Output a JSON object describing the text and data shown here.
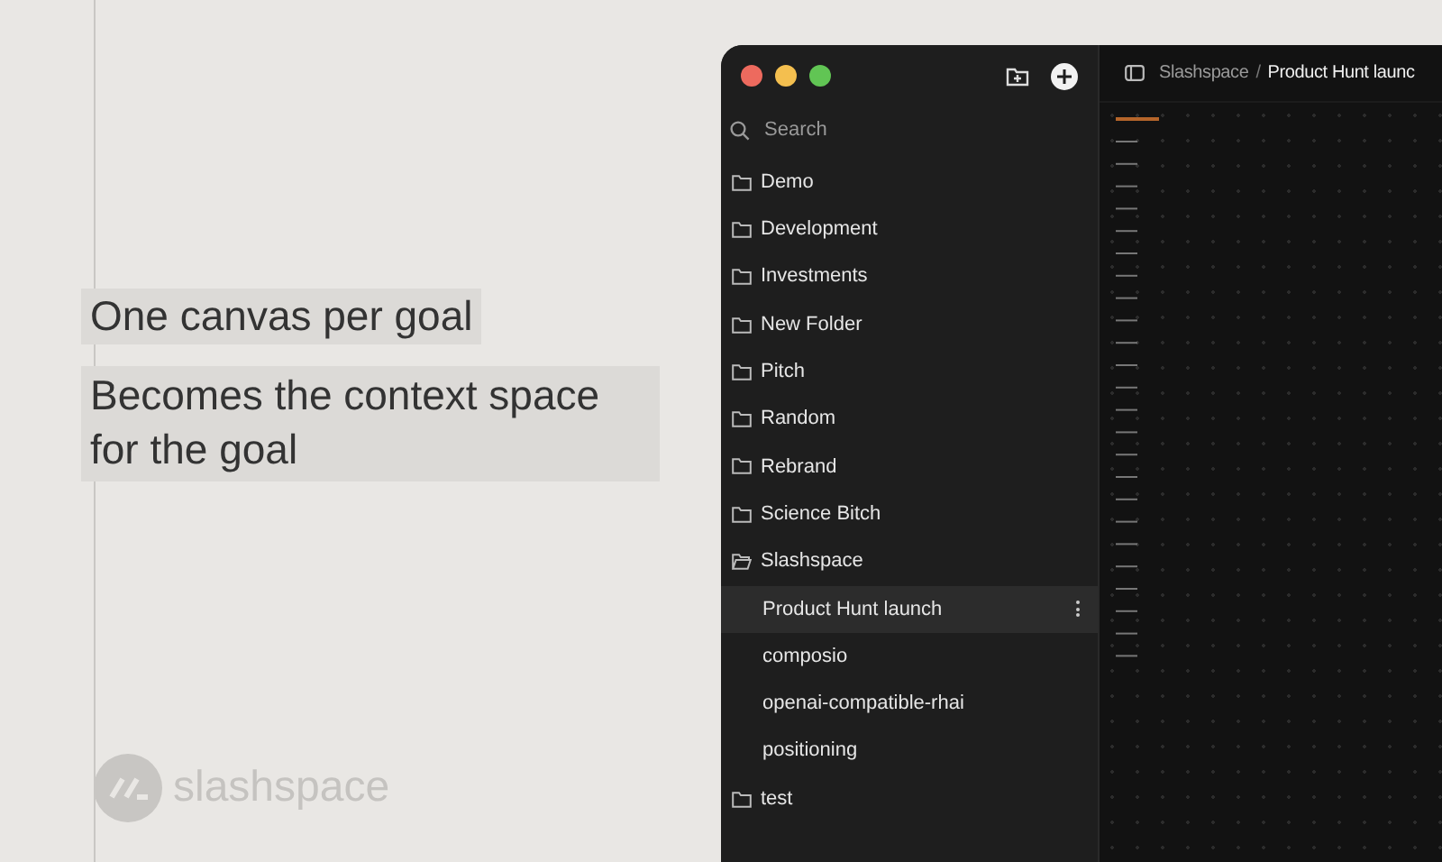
{
  "captions": [
    "One canvas per goal",
    "Becomes the context space for the goal"
  ],
  "logo": {
    "text": "slashspace"
  },
  "sidebar": {
    "search": {
      "placeholder": "Search"
    },
    "items": [
      {
        "label": "Demo",
        "kind": "folder",
        "expanded": false,
        "selected": false
      },
      {
        "label": "Development",
        "kind": "folder",
        "expanded": false,
        "selected": false
      },
      {
        "label": "Investments",
        "kind": "folder",
        "expanded": false,
        "selected": false
      },
      {
        "label": "New Folder",
        "kind": "folder",
        "expanded": false,
        "selected": false
      },
      {
        "label": "Pitch",
        "kind": "folder",
        "expanded": false,
        "selected": false
      },
      {
        "label": "Random",
        "kind": "folder",
        "expanded": false,
        "selected": false
      },
      {
        "label": "Rebrand",
        "kind": "folder",
        "expanded": false,
        "selected": false
      },
      {
        "label": "Science Bitch",
        "kind": "folder",
        "expanded": false,
        "selected": false
      },
      {
        "label": "Slashspace",
        "kind": "folder",
        "expanded": true,
        "selected": false,
        "children": [
          {
            "label": "Product Hunt launch",
            "kind": "canvas",
            "selected": true
          },
          {
            "label": "composio",
            "kind": "canvas",
            "selected": false
          },
          {
            "label": "openai-compatible-rhai",
            "kind": "canvas",
            "selected": false
          },
          {
            "label": "positioning",
            "kind": "canvas",
            "selected": false
          }
        ]
      },
      {
        "label": "test",
        "kind": "folder",
        "expanded": false,
        "selected": false
      }
    ]
  },
  "breadcrumb": {
    "separator": "/",
    "items": [
      "Slashspace",
      "Product Hunt launc"
    ]
  }
}
